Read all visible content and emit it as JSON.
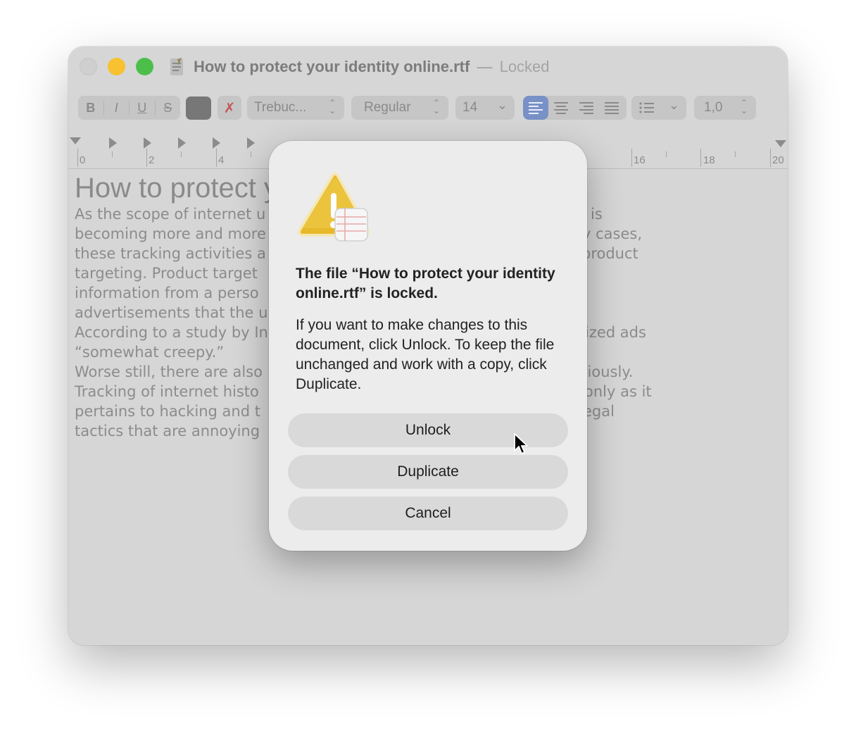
{
  "window": {
    "file_name": "How to protect your identity online.rtf",
    "separator": "—",
    "lock_status": "Locked"
  },
  "toolbar": {
    "bold": "B",
    "italic": "I",
    "underline": "U",
    "strikethrough": "S",
    "text_color": "#777777",
    "font_family": "Trebuc...",
    "font_style": "Regular",
    "font_size": "14",
    "alignment_selected": "left",
    "line_spacing": "1,0"
  },
  "ruler": {
    "labels": [
      "0",
      "2",
      "4",
      "16",
      "18",
      "20"
    ]
  },
  "document": {
    "heading": "How to protect your identity online",
    "lines": [
      "As the scope of internet u",
      "becoming more and more",
      "these tracking activities a",
      "targeting. Product target",
      "information from a perso",
      "advertisements that the u",
      "According to a study by In",
      "“somewhat creepy.”",
      "Worse still, there are also",
      "Tracking of internet histo",
      "pertains to hacking and t",
      "tactics that are annoying"
    ],
    "right_fragments": [
      "is",
      "y cases,",
      "product",
      "",
      "",
      "",
      "ized ads",
      "",
      "ciously.",
      "only as it",
      "egal",
      ""
    ]
  },
  "dialog": {
    "title": "The file “How to protect your identity online.rtf” is locked.",
    "message": "If you want to make changes to this document, click Unlock. To keep the file unchanged and work with a copy, click Duplicate.",
    "buttons": {
      "unlock": "Unlock",
      "duplicate": "Duplicate",
      "cancel": "Cancel"
    }
  }
}
